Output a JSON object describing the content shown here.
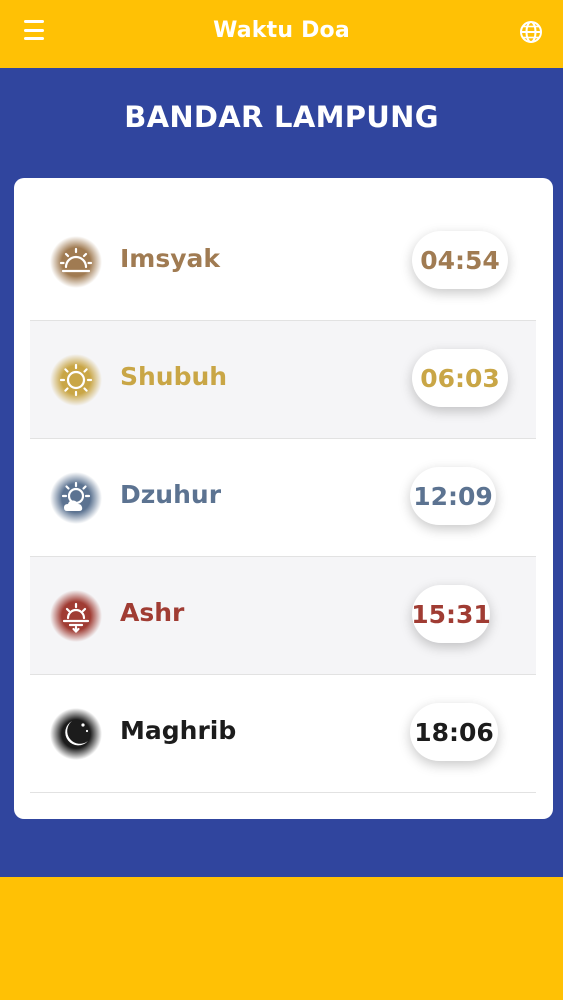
{
  "header": {
    "title": "Waktu Doa",
    "menu_icon": "menu-icon",
    "globe_icon": "globe-icon"
  },
  "location": {
    "city": "BANDAR LAMPUNG"
  },
  "colors": {
    "header": "#ffc105",
    "background": "#30459e",
    "card": "#ffffff"
  },
  "prayers": [
    {
      "name": "Imsyak",
      "time": "04:54",
      "color": "#a07b52",
      "icon": "sunrise-icon"
    },
    {
      "name": "Shubuh",
      "time": "06:03",
      "color": "#c9a646",
      "icon": "sun-icon"
    },
    {
      "name": "Dzuhur",
      "time": "12:09",
      "color": "#5c7391",
      "icon": "sun-cloud-icon"
    },
    {
      "name": "Ashr",
      "time": "15:31",
      "color": "#a03c33",
      "icon": "sunset-icon"
    },
    {
      "name": "Maghrib",
      "time": "18:06",
      "color": "#1c1c1c",
      "icon": "moon-icon"
    }
  ]
}
